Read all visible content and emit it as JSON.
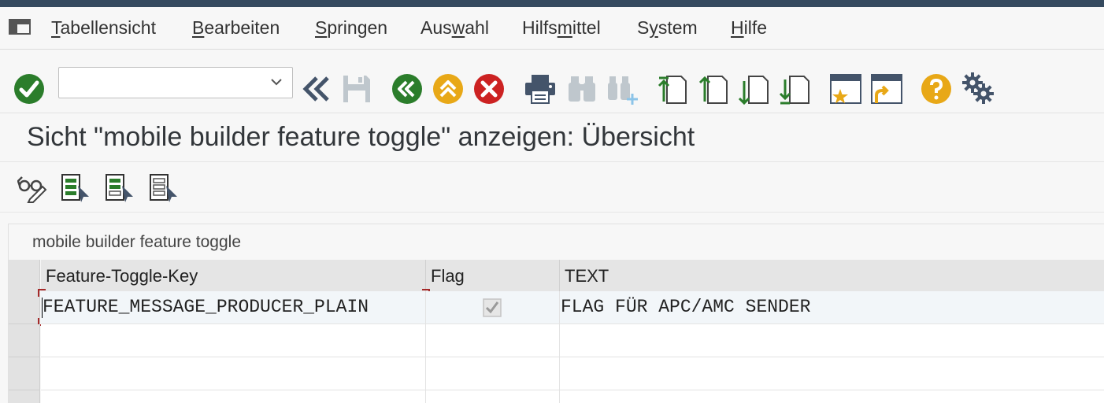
{
  "menubar": {
    "items": [
      {
        "pre": "",
        "mn": "T",
        "post": "abellensicht"
      },
      {
        "pre": "",
        "mn": "B",
        "post": "earbeiten"
      },
      {
        "pre": "",
        "mn": "S",
        "post": "pringen"
      },
      {
        "pre": "Aus",
        "mn": "w",
        "post": "ahl"
      },
      {
        "pre": "Hilfs",
        "mn": "m",
        "post": "ittel"
      },
      {
        "pre": "S",
        "mn": "y",
        "post": "stem"
      },
      {
        "pre": "",
        "mn": "H",
        "post": "ilfe"
      }
    ]
  },
  "toolbar": {
    "command_field_value": "",
    "icons": [
      "enter-check-icon",
      "command-dropdown-chevron-icon",
      "collapse-toolbar-icon",
      "save-icon",
      "back-icon",
      "exit-icon",
      "cancel-icon",
      "print-icon",
      "find-icon",
      "find-next-icon",
      "first-page-icon",
      "previous-page-icon",
      "next-page-icon",
      "last-page-icon",
      "create-session-icon",
      "generate-shortcut-icon",
      "help-icon",
      "customize-layout-icon"
    ],
    "colors": {
      "green": "#2b7d2b",
      "yellow": "#e8a817",
      "red": "#cc2222",
      "teal": "#2b7d2b",
      "disabled": "#bfc7cd",
      "navy": "#44546a"
    }
  },
  "title": "Sicht \"mobile builder feature toggle\" anzeigen: Übersicht",
  "app_toolbar": {
    "icons": [
      "display-change-icon",
      "select-all-icon",
      "select-block-icon",
      "deselect-all-icon"
    ]
  },
  "table": {
    "title": "mobile builder feature toggle",
    "columns": [
      "Feature-Toggle-Key",
      "Flag",
      "TEXT"
    ],
    "rows": [
      {
        "key": "FEATURE_MESSAGE_PRODUCER_PLAIN",
        "flag": true,
        "text": "FLAG FÜR APC/AMC SENDER"
      },
      {
        "key": "",
        "flag": false,
        "text": ""
      },
      {
        "key": "",
        "flag": false,
        "text": ""
      }
    ]
  }
}
